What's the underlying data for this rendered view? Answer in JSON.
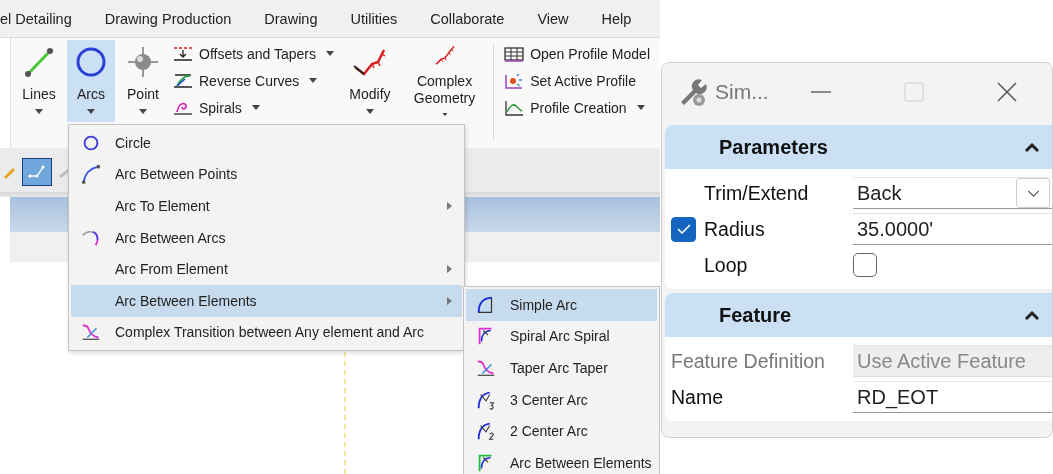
{
  "menu_bar": {
    "items": [
      "el Detailing",
      "Drawing Production",
      "Drawing",
      "Utilities",
      "Collaborate",
      "View",
      "Help"
    ]
  },
  "ribbon": {
    "groups": [
      {
        "kind": "large",
        "divider_before": false,
        "buttons": [
          {
            "label": "Lines",
            "selected": false,
            "dropdown": true
          },
          {
            "label": "Arcs",
            "selected": true,
            "dropdown": true
          },
          {
            "label": "Point",
            "selected": false,
            "dropdown": true
          }
        ]
      },
      {
        "kind": "small",
        "divider_before": false,
        "buttons": [
          {
            "label": "Offsets and Tapers",
            "selected": false,
            "dropdown": true
          },
          {
            "label": "Reverse Curves",
            "selected": false,
            "dropdown": true
          },
          {
            "label": "Spirals",
            "selected": false,
            "dropdown": true
          }
        ]
      },
      {
        "kind": "large",
        "divider_before": false,
        "buttons": [
          {
            "label": "Modify",
            "selected": false,
            "dropdown": true
          },
          {
            "label": "Complex Geometry",
            "selected": false,
            "dropdown": true
          }
        ]
      },
      {
        "kind": "small",
        "divider_before": true,
        "buttons": [
          {
            "label": "Open Profile Model",
            "selected": false,
            "dropdown": false
          },
          {
            "label": "Set Active Profile",
            "selected": false,
            "dropdown": false
          },
          {
            "label": "Profile Creation",
            "selected": false,
            "dropdown": true
          }
        ]
      }
    ]
  },
  "toolbar": {
    "tools": [
      {
        "selected": false
      },
      {
        "selected": true
      },
      {
        "selected": false
      }
    ]
  },
  "arcs_menu": {
    "items": [
      {
        "label": "Circle",
        "selected": false,
        "submenu": false
      },
      {
        "label": "Arc Between Points",
        "selected": false,
        "submenu": false
      },
      {
        "label": "Arc To Element",
        "selected": false,
        "submenu": true
      },
      {
        "label": "Arc Between Arcs",
        "selected": false,
        "submenu": false
      },
      {
        "label": "Arc From Element",
        "selected": false,
        "submenu": true
      },
      {
        "label": "Arc Between Elements",
        "selected": true,
        "submenu": true
      },
      {
        "label": "Complex Transition between Any element and Arc",
        "selected": false,
        "submenu": false
      }
    ]
  },
  "submenu": {
    "items": [
      {
        "label": "Simple Arc",
        "selected": true
      },
      {
        "label": "Spiral Arc Spiral",
        "selected": false
      },
      {
        "label": "Taper Arc Taper",
        "selected": false
      },
      {
        "label": "3 Center Arc",
        "selected": false
      },
      {
        "label": "2 Center Arc",
        "selected": false
      },
      {
        "label": "Arc Between Elements",
        "selected": false
      }
    ]
  },
  "dialog": {
    "title": "Sim...",
    "maximize_enabled": false,
    "sections": [
      {
        "title": "Parameters",
        "expanded": true,
        "rows": [
          {
            "kind": "dropdown",
            "label": "Trim/Extend",
            "value": "Back",
            "disabled": false
          },
          {
            "kind": "text",
            "label": "Radius",
            "value": "35.0000'",
            "disabled": false,
            "lock": {
              "checked": true
            }
          },
          {
            "kind": "checkbox",
            "label": "Loop",
            "checked": false,
            "disabled": false
          }
        ]
      },
      {
        "title": "Feature",
        "expanded": true,
        "rows": [
          {
            "kind": "text",
            "label": "Feature Definition",
            "value": "Use Active Feature",
            "disabled": true
          },
          {
            "kind": "text",
            "label": "Name",
            "value": "RD_EOT",
            "disabled": false
          }
        ]
      }
    ]
  }
}
